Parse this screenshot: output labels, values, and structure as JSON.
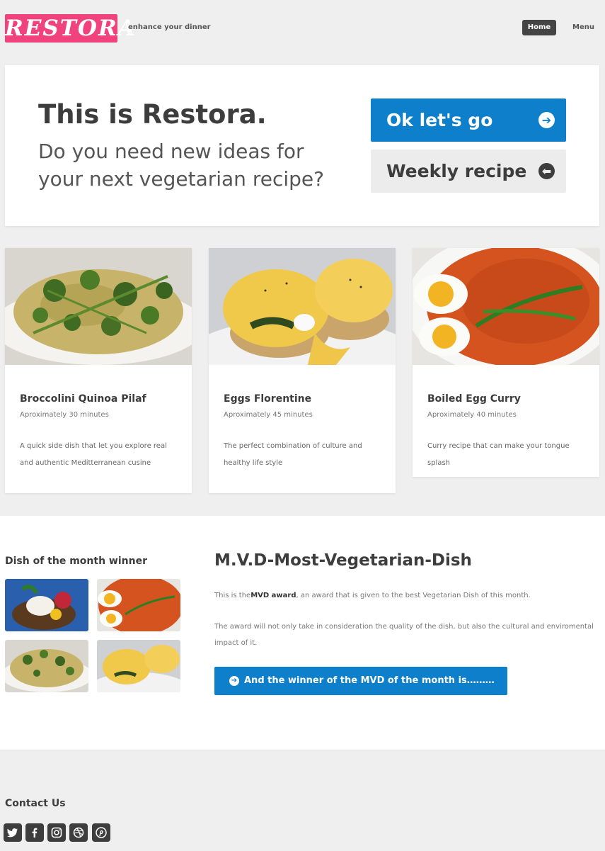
{
  "header": {
    "logo": "RESTORA",
    "tagline": "enhance your dinner",
    "nav": {
      "home": "Home",
      "menu": "Menu"
    }
  },
  "hero": {
    "title": "This is Restora.",
    "subtitle": "Do you need new ideas for your next vegetarian recipe?",
    "primary_button": "Ok let's go",
    "secondary_button": "Weekly recipe"
  },
  "cards": [
    {
      "title": "Broccolini Quinoa Pilaf",
      "time": "Aproximately 30 minutes",
      "description": "A quick side dish that let you explore real and authentic Meditterranean cusine"
    },
    {
      "title": "Eggs Florentine",
      "time": "Aproximately 45 minutes",
      "description": "The perfect combination of culture and healthy life style"
    },
    {
      "title": "Boiled Egg Curry",
      "time": "Aproximately 40 minutes",
      "description": "Curry recipe that can make your tongue splash"
    }
  ],
  "dish_of_month": {
    "title": "Dish of the month winner"
  },
  "mvd": {
    "title": "M.V.D-Most-Vegetarian-Dish",
    "p1_pre": "This is the",
    "p1_bold": "MVD award",
    "p1_post": ", an award that is given to the best Vegetarian Dish of this month.",
    "p2": "The award will not only take in consideration the quality of the dish, but also the cultural and enviromental impact of it.",
    "button": "And the winner of the MVD of the month is………"
  },
  "footer": {
    "contact_title": "Contact Us",
    "social_icons": [
      "twitter-icon",
      "facebook-icon",
      "instagram-icon",
      "dribbble-icon",
      "pinterest-icon"
    ]
  },
  "colors": {
    "brand_pink": "#f0437e",
    "primary_blue": "#0d7fcb",
    "dark": "#3d3d3d"
  }
}
